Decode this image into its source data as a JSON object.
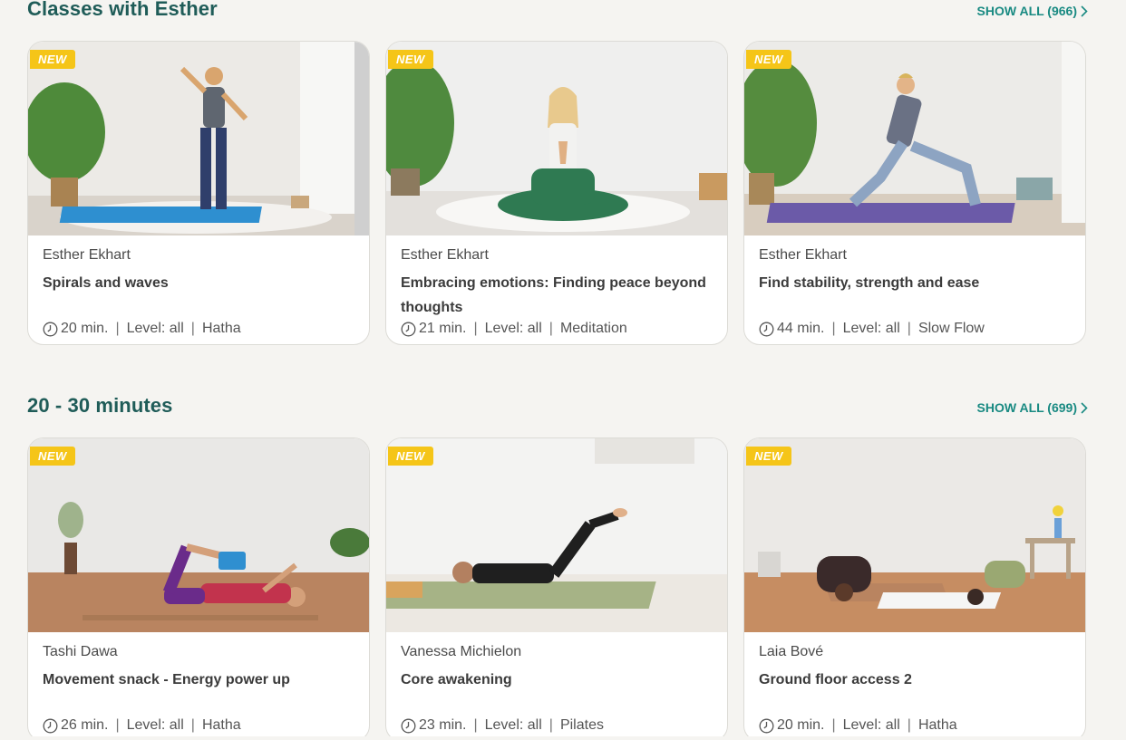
{
  "colors": {
    "heading": "#1f5c58",
    "link": "#198a82",
    "badge": "#f5c518",
    "background": "#f5f4f1"
  },
  "sections": [
    {
      "title": "Classes with Esther",
      "show_all": "SHOW ALL (966)",
      "cards": [
        {
          "badge": "NEW",
          "teacher": "Esther Ekhart",
          "title": "Spirals and waves",
          "duration": "20 min.",
          "level": "Level: all",
          "style": "Hatha"
        },
        {
          "badge": "NEW",
          "teacher": "Esther Ekhart",
          "title": "Embracing emotions: Finding peace beyond thoughts",
          "duration": "21 min.",
          "level": "Level: all",
          "style": "Meditation"
        },
        {
          "badge": "NEW",
          "teacher": "Esther Ekhart",
          "title": "Find stability, strength and ease",
          "duration": "44 min.",
          "level": "Level: all",
          "style": "Slow Flow"
        }
      ]
    },
    {
      "title": "20 - 30 minutes",
      "show_all": "SHOW ALL (699)",
      "cards": [
        {
          "badge": "NEW",
          "teacher": "Tashi Dawa",
          "title": "Movement snack - Energy power up",
          "duration": "26 min.",
          "level": "Level: all",
          "style": "Hatha"
        },
        {
          "badge": "NEW",
          "teacher": "Vanessa Michielon",
          "title": "Core awakening",
          "duration": "23 min.",
          "level": "Level: all",
          "style": "Pilates"
        },
        {
          "badge": "NEW",
          "teacher": "Laia Bové",
          "title": "Ground floor access 2",
          "duration": "20 min.",
          "level": "Level: all",
          "style": "Hatha"
        }
      ]
    }
  ],
  "icons": {
    "duration": "clock-icon",
    "show_all": "chevron-right-icon"
  }
}
